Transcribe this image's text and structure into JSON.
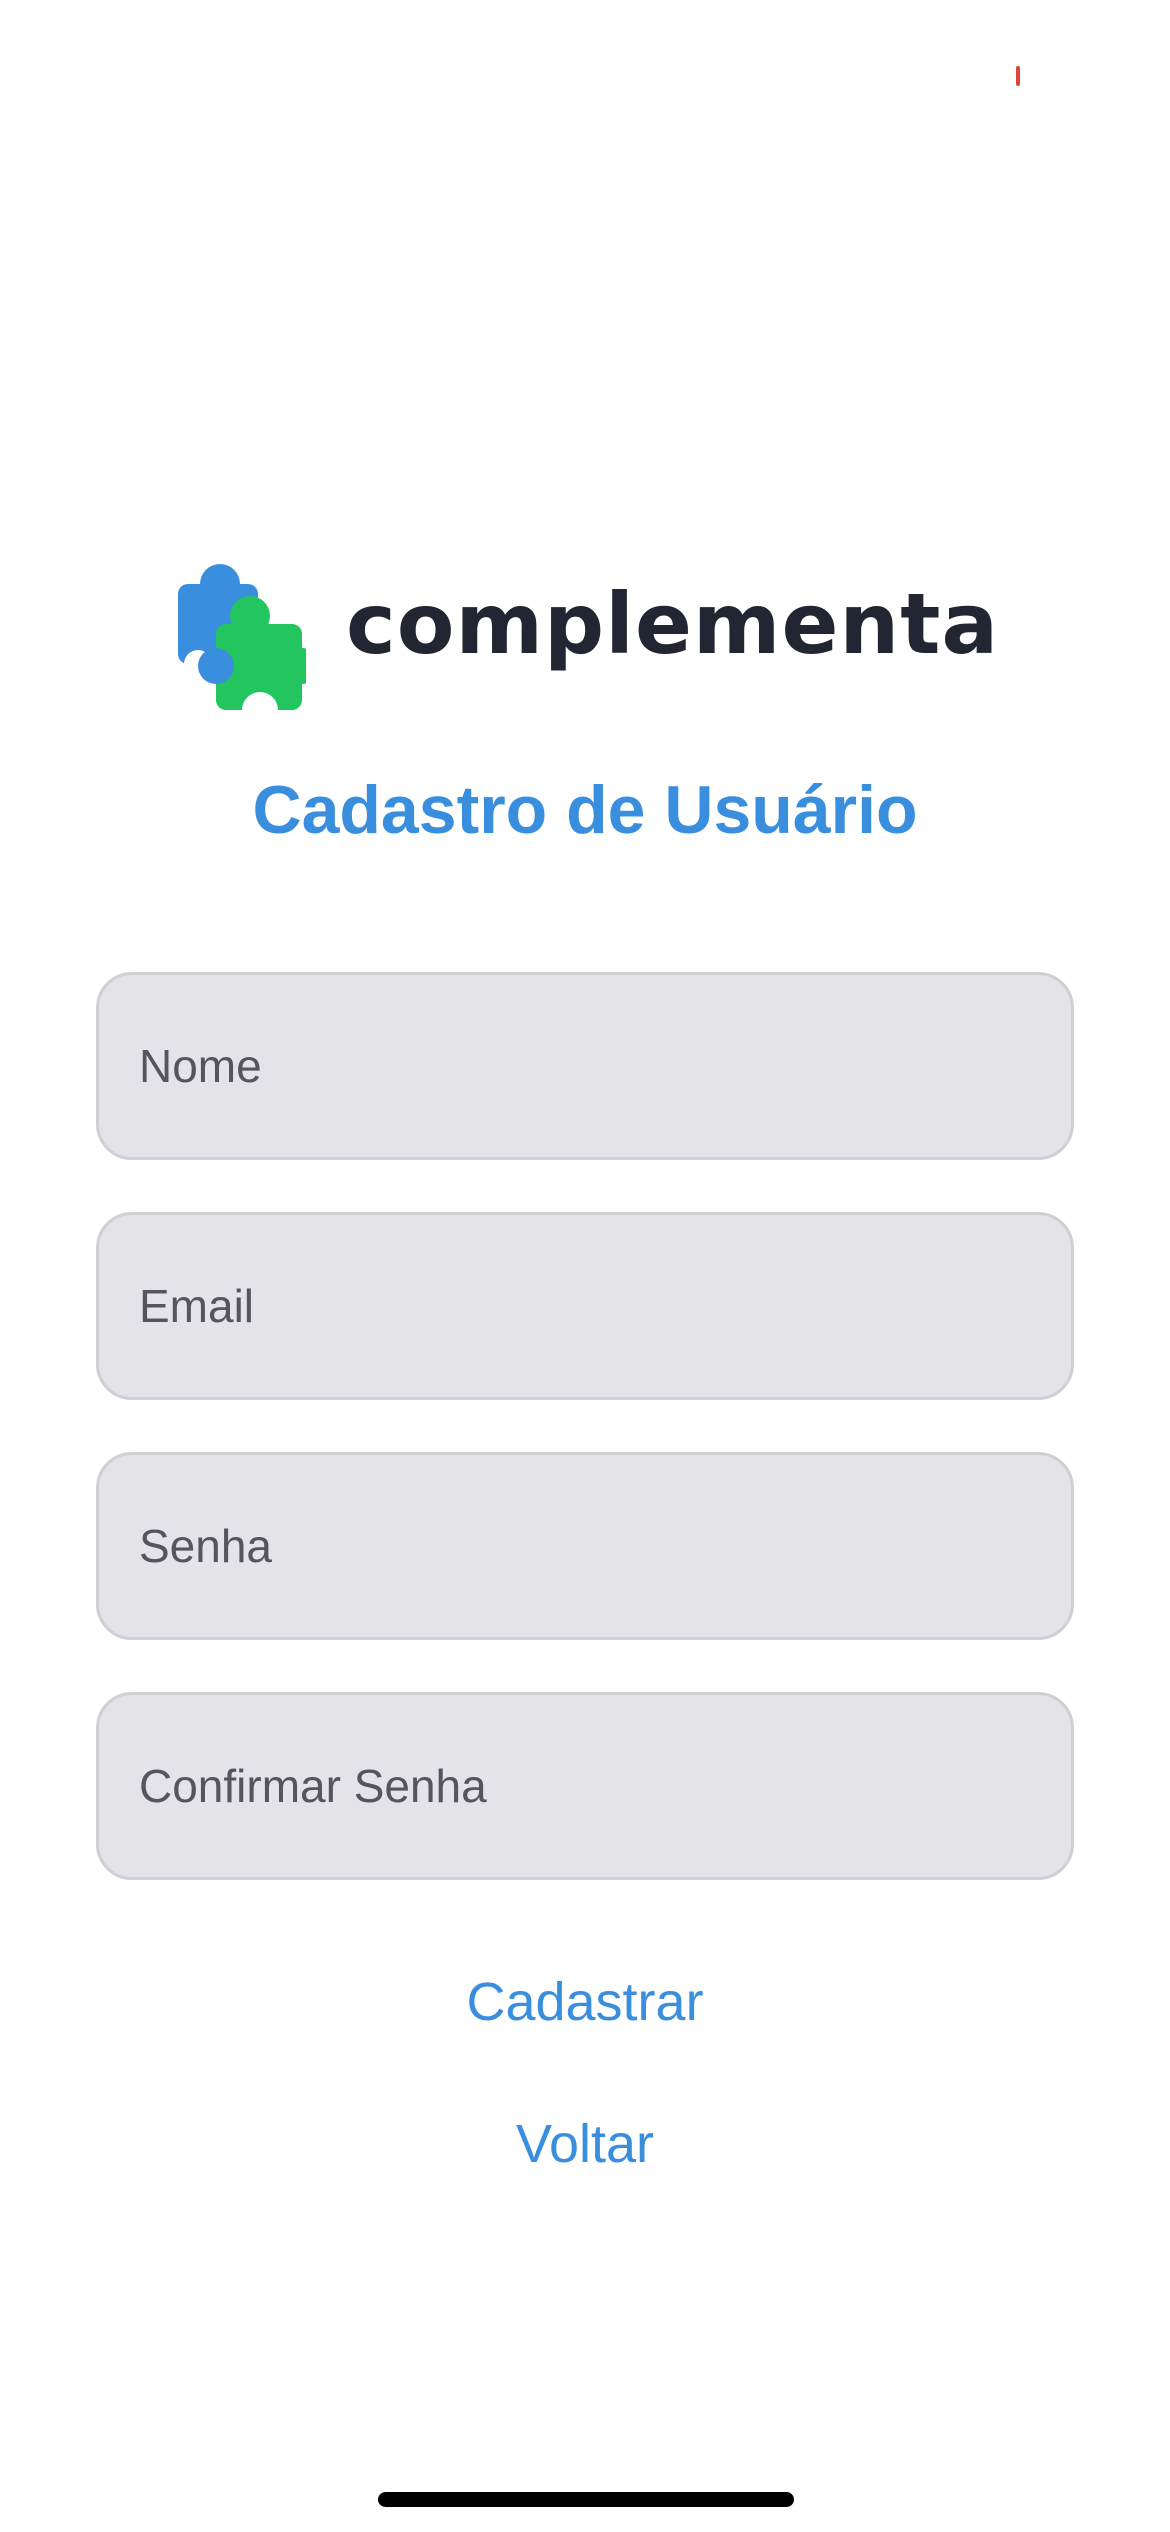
{
  "brand": {
    "name": "complementa",
    "colors": {
      "puzzle_blue": "#3a8ede",
      "puzzle_green": "#22c55e",
      "text": "#222632"
    }
  },
  "page": {
    "title": "Cadastro de Usuário",
    "accent_color": "#3a8ede"
  },
  "form": {
    "fields": [
      {
        "placeholder": "Nome",
        "value": ""
      },
      {
        "placeholder": "Email",
        "value": ""
      },
      {
        "placeholder": "Senha",
        "value": ""
      },
      {
        "placeholder": "Confirmar Senha",
        "value": ""
      }
    ],
    "submit_label": "Cadastrar",
    "back_label": "Voltar"
  },
  "icons": {
    "logo": "puzzle-pieces-icon"
  }
}
